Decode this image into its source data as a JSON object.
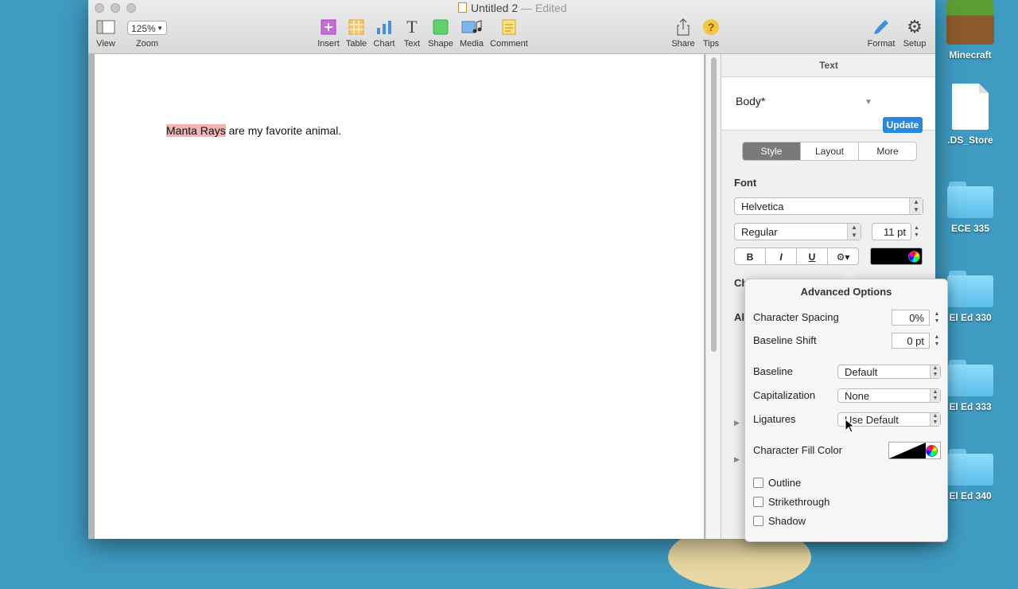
{
  "window": {
    "title": "Untitled 2",
    "separator": "—",
    "status": "Edited"
  },
  "toolbar": {
    "view": "View",
    "zoom_value": "125%",
    "zoom": "Zoom",
    "insert": "Insert",
    "table": "Table",
    "chart": "Chart",
    "text": "Text",
    "shape": "Shape",
    "media": "Media",
    "comment": "Comment",
    "share": "Share",
    "tips": "Tips",
    "format": "Format",
    "setup": "Setup"
  },
  "document": {
    "highlighted": "Manta Rays",
    "rest": " are my favorite animal."
  },
  "inspector": {
    "title": "Text",
    "paragraph_style": "Body*",
    "update": "Update",
    "tabs": [
      "Style",
      "Layout",
      "More"
    ],
    "font_heading": "Font",
    "font_family": "Helvetica",
    "font_typeface": "Regular",
    "font_size": "11 pt",
    "bold": "B",
    "italic": "I",
    "underline": "U",
    "partial_char": "Ch",
    "partial_align": "Ali"
  },
  "advanced": {
    "title": "Advanced Options",
    "char_spacing_label": "Character Spacing",
    "char_spacing_value": "0%",
    "baseline_shift_label": "Baseline Shift",
    "baseline_shift_value": "0 pt",
    "baseline_label": "Baseline",
    "baseline_value": "Default",
    "capitalization_label": "Capitalization",
    "capitalization_value": "None",
    "ligatures_label": "Ligatures",
    "ligatures_value": "Use Default",
    "fill_color_label": "Character Fill Color",
    "outline": "Outline",
    "strikethrough": "Strikethrough",
    "shadow": "Shadow"
  },
  "desktop": {
    "items": [
      "Minecraft",
      ".DS_Store",
      "ECE 335",
      "El Ed 330",
      "El Ed 333",
      "El Ed 340"
    ]
  },
  "colors": {
    "accent": "#2b88e0",
    "highlight": "#f2b3b3",
    "desktop": "#3f9bc2"
  }
}
